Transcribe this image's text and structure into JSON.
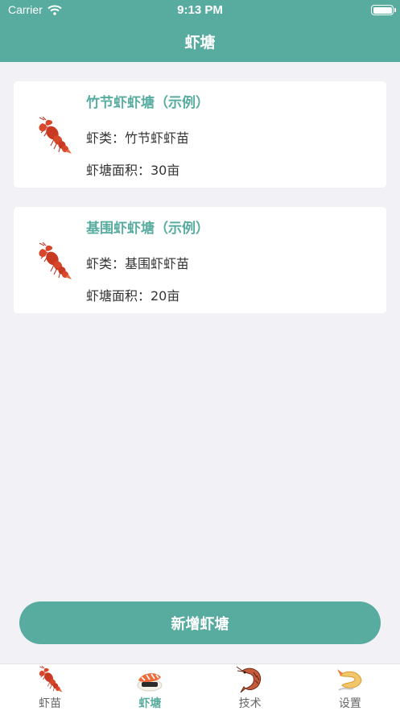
{
  "status_bar": {
    "carrier": "Carrier",
    "time": "9:13 PM"
  },
  "nav": {
    "title": "虾塘"
  },
  "ponds": [
    {
      "title": "竹节虾虾塘（示例）",
      "species": "虾类：竹节虾虾苗",
      "area": "虾塘面积：30亩",
      "icon": "crayfish-icon"
    },
    {
      "title": "基围虾虾塘（示例）",
      "species": "虾类：基围虾虾苗",
      "area": "虾塘面积：20亩",
      "icon": "crayfish-icon"
    }
  ],
  "add_button": {
    "label": "新增虾塘"
  },
  "tabbar": {
    "tabs": [
      {
        "label": "虾苗",
        "icon": "lobster-icon",
        "active": false
      },
      {
        "label": "虾塘",
        "icon": "shrimp-sushi-icon",
        "active": true
      },
      {
        "label": "技术",
        "icon": "shrimp-icon",
        "active": false
      },
      {
        "label": "设置",
        "icon": "fried-shrimp-icon",
        "active": false
      }
    ]
  },
  "colors": {
    "accent": "#58ac9f",
    "background": "#f2f1f6",
    "card": "#ffffff"
  }
}
